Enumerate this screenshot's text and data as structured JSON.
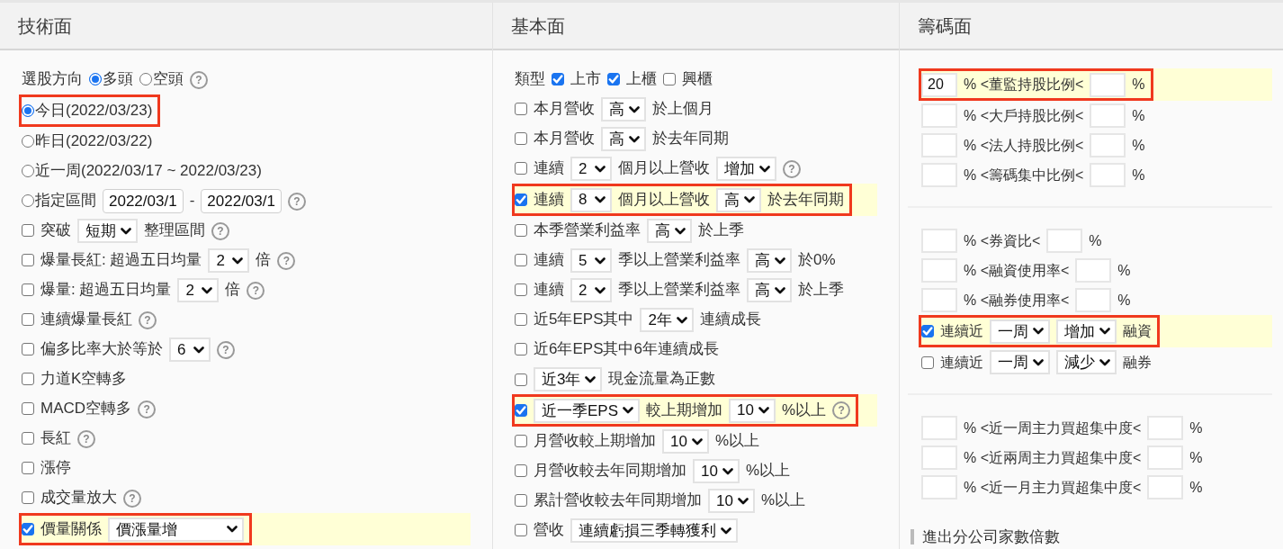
{
  "columns": [
    {
      "title": "技術面",
      "groups": [
        {
          "rows": [
            {
              "highlighted": false,
              "boxed": false,
              "parts": [
                {
                  "kind": "text",
                  "text": "選股方向"
                },
                {
                  "kind": "radio",
                  "selected": true,
                  "label": "多頭"
                },
                {
                  "kind": "radio",
                  "selected": false,
                  "label": "空頭"
                },
                {
                  "kind": "help",
                  "label": "?"
                }
              ]
            },
            {
              "highlighted": false,
              "boxed": true,
              "parts": [
                {
                  "kind": "radio",
                  "selected": true,
                  "label": "今日(2022/03/23)"
                }
              ]
            },
            {
              "highlighted": false,
              "boxed": false,
              "parts": [
                {
                  "kind": "radio",
                  "selected": false,
                  "label": "昨日(2022/03/22)"
                }
              ]
            },
            {
              "highlighted": false,
              "boxed": false,
              "parts": [
                {
                  "kind": "radio",
                  "selected": false,
                  "label": "近一周(2022/03/17 ~ 2022/03/23)"
                }
              ]
            },
            {
              "highlighted": false,
              "boxed": false,
              "parts": [
                {
                  "kind": "radio",
                  "selected": false,
                  "label": "指定區間"
                },
                {
                  "kind": "input",
                  "value": "2022/03/1"
                },
                {
                  "kind": "text",
                  "text": "-"
                },
                {
                  "kind": "input",
                  "value": "2022/03/1"
                },
                {
                  "kind": "help",
                  "label": "?"
                }
              ]
            },
            {
              "highlighted": false,
              "boxed": false,
              "parts": [
                {
                  "kind": "checkbox",
                  "checked": false,
                  "label": "突破"
                },
                {
                  "kind": "select",
                  "value": "短期"
                },
                {
                  "kind": "text",
                  "text": "整理區間"
                },
                {
                  "kind": "help",
                  "label": "?"
                }
              ]
            },
            {
              "highlighted": false,
              "boxed": false,
              "parts": [
                {
                  "kind": "checkbox",
                  "checked": false,
                  "label": "爆量長紅: 超過五日均量"
                },
                {
                  "kind": "select",
                  "value": "2"
                },
                {
                  "kind": "text",
                  "text": "倍"
                },
                {
                  "kind": "help",
                  "label": "?"
                }
              ]
            },
            {
              "highlighted": false,
              "boxed": false,
              "parts": [
                {
                  "kind": "checkbox",
                  "checked": false,
                  "label": "爆量: 超過五日均量"
                },
                {
                  "kind": "select",
                  "value": "2"
                },
                {
                  "kind": "text",
                  "text": "倍"
                },
                {
                  "kind": "help",
                  "label": "?"
                }
              ]
            },
            {
              "highlighted": false,
              "boxed": false,
              "parts": [
                {
                  "kind": "checkbox",
                  "checked": false,
                  "label": "連續爆量長紅"
                },
                {
                  "kind": "help",
                  "label": "?"
                }
              ]
            },
            {
              "highlighted": false,
              "boxed": false,
              "parts": [
                {
                  "kind": "checkbox",
                  "checked": false,
                  "label": "偏多比率大於等於"
                },
                {
                  "kind": "select",
                  "value": "6"
                },
                {
                  "kind": "help",
                  "label": "?"
                }
              ]
            },
            {
              "highlighted": false,
              "boxed": false,
              "parts": [
                {
                  "kind": "checkbox",
                  "checked": false,
                  "label": "力道K空轉多"
                }
              ]
            },
            {
              "highlighted": false,
              "boxed": false,
              "parts": [
                {
                  "kind": "checkbox",
                  "checked": false,
                  "label": "MACD空轉多"
                },
                {
                  "kind": "help",
                  "label": "?"
                }
              ]
            },
            {
              "highlighted": false,
              "boxed": false,
              "parts": [
                {
                  "kind": "checkbox",
                  "checked": false,
                  "label": "長紅"
                },
                {
                  "kind": "help",
                  "label": "?"
                }
              ]
            },
            {
              "highlighted": false,
              "boxed": false,
              "parts": [
                {
                  "kind": "checkbox",
                  "checked": false,
                  "label": "漲停"
                }
              ]
            },
            {
              "highlighted": false,
              "boxed": false,
              "parts": [
                {
                  "kind": "checkbox",
                  "checked": false,
                  "label": "成交量放大"
                },
                {
                  "kind": "help",
                  "label": "?"
                }
              ]
            },
            {
              "highlighted": true,
              "boxed": true,
              "parts": [
                {
                  "kind": "checkbox",
                  "checked": true,
                  "label": "價量關係"
                },
                {
                  "kind": "select",
                  "value": "價漲量增"
                }
              ]
            }
          ]
        }
      ]
    },
    {
      "title": "基本面",
      "groups": [
        {
          "rows": [
            {
              "highlighted": false,
              "boxed": false,
              "parts": [
                {
                  "kind": "text",
                  "text": "類型"
                },
                {
                  "kind": "checkbox",
                  "checked": true,
                  "label": "上市"
                },
                {
                  "kind": "checkbox",
                  "checked": true,
                  "label": "上櫃"
                },
                {
                  "kind": "checkbox",
                  "checked": false,
                  "label": "興櫃"
                }
              ]
            },
            {
              "highlighted": false,
              "boxed": false,
              "parts": [
                {
                  "kind": "checkbox",
                  "checked": false,
                  "label": "本月營收"
                },
                {
                  "kind": "select",
                  "value": "高"
                },
                {
                  "kind": "text",
                  "text": "於上個月"
                }
              ]
            },
            {
              "highlighted": false,
              "boxed": false,
              "parts": [
                {
                  "kind": "checkbox",
                  "checked": false,
                  "label": "本月營收"
                },
                {
                  "kind": "select",
                  "value": "高"
                },
                {
                  "kind": "text",
                  "text": "於去年同期"
                }
              ]
            },
            {
              "highlighted": false,
              "boxed": false,
              "parts": [
                {
                  "kind": "checkbox",
                  "checked": false,
                  "label": "連續"
                },
                {
                  "kind": "select",
                  "value": "2"
                },
                {
                  "kind": "text",
                  "text": "個月以上營收"
                },
                {
                  "kind": "select",
                  "value": "增加"
                },
                {
                  "kind": "help",
                  "label": "?"
                }
              ]
            },
            {
              "highlighted": true,
              "boxed": true,
              "parts": [
                {
                  "kind": "checkbox",
                  "checked": true,
                  "label": "連續"
                },
                {
                  "kind": "select",
                  "value": "8"
                },
                {
                  "kind": "text",
                  "text": "個月以上營收"
                },
                {
                  "kind": "select",
                  "value": "高"
                },
                {
                  "kind": "text",
                  "text": "於去年同期"
                }
              ]
            },
            {
              "highlighted": false,
              "boxed": false,
              "parts": [
                {
                  "kind": "checkbox",
                  "checked": false,
                  "label": "本季營業利益率"
                },
                {
                  "kind": "select",
                  "value": "高"
                },
                {
                  "kind": "text",
                  "text": "於上季"
                }
              ]
            },
            {
              "highlighted": false,
              "boxed": false,
              "parts": [
                {
                  "kind": "checkbox",
                  "checked": false,
                  "label": "連續"
                },
                {
                  "kind": "select",
                  "value": "5"
                },
                {
                  "kind": "text",
                  "text": "季以上營業利益率"
                },
                {
                  "kind": "select",
                  "value": "高"
                },
                {
                  "kind": "text",
                  "text": "於0%"
                }
              ]
            },
            {
              "highlighted": false,
              "boxed": false,
              "parts": [
                {
                  "kind": "checkbox",
                  "checked": false,
                  "label": "連續"
                },
                {
                  "kind": "select",
                  "value": "2"
                },
                {
                  "kind": "text",
                  "text": "季以上營業利益率"
                },
                {
                  "kind": "select",
                  "value": "高"
                },
                {
                  "kind": "text",
                  "text": "於上季"
                }
              ]
            },
            {
              "highlighted": false,
              "boxed": false,
              "parts": [
                {
                  "kind": "checkbox",
                  "checked": false,
                  "label": "近5年EPS其中"
                },
                {
                  "kind": "select",
                  "value": "2年"
                },
                {
                  "kind": "text",
                  "text": "連續成長"
                }
              ]
            },
            {
              "highlighted": false,
              "boxed": false,
              "parts": [
                {
                  "kind": "checkbox",
                  "checked": false,
                  "label": "近6年EPS其中6年連續成長"
                }
              ]
            },
            {
              "highlighted": false,
              "boxed": false,
              "parts": [
                {
                  "kind": "checkbox",
                  "checked": false
                },
                {
                  "kind": "select",
                  "value": "近3年"
                },
                {
                  "kind": "text",
                  "text": "現金流量為正數"
                }
              ]
            },
            {
              "highlighted": true,
              "boxed": true,
              "parts": [
                {
                  "kind": "checkbox",
                  "checked": true
                },
                {
                  "kind": "select",
                  "value": "近一季EPS"
                },
                {
                  "kind": "text",
                  "text": "較上期增加"
                },
                {
                  "kind": "select",
                  "value": "10"
                },
                {
                  "kind": "text",
                  "text": "%以上"
                },
                {
                  "kind": "help",
                  "label": "?"
                }
              ]
            },
            {
              "highlighted": false,
              "boxed": false,
              "parts": [
                {
                  "kind": "checkbox",
                  "checked": false,
                  "label": "月營收較上期增加"
                },
                {
                  "kind": "select",
                  "value": "10"
                },
                {
                  "kind": "text",
                  "text": "%以上"
                }
              ]
            },
            {
              "highlighted": false,
              "boxed": false,
              "parts": [
                {
                  "kind": "checkbox",
                  "checked": false,
                  "label": "月營收較去年同期增加"
                },
                {
                  "kind": "select",
                  "value": "10"
                },
                {
                  "kind": "text",
                  "text": "%以上"
                }
              ]
            },
            {
              "highlighted": false,
              "boxed": false,
              "parts": [
                {
                  "kind": "checkbox",
                  "checked": false,
                  "label": "累計營收較去年同期增加"
                },
                {
                  "kind": "select",
                  "value": "10"
                },
                {
                  "kind": "text",
                  "text": "%以上"
                }
              ]
            },
            {
              "highlighted": false,
              "boxed": false,
              "parts": [
                {
                  "kind": "checkbox",
                  "checked": false,
                  "label": "營收"
                },
                {
                  "kind": "select",
                  "value": "連續虧損三季轉獲利"
                }
              ]
            }
          ]
        }
      ]
    },
    {
      "title": "籌碼面",
      "groups": [
        {
          "rows": [
            {
              "highlighted": true,
              "boxed": true,
              "parts": [
                {
                  "kind": "input",
                  "value": "20"
                },
                {
                  "kind": "text",
                  "text": "% <董監持股比例<"
                },
                {
                  "kind": "input"
                },
                {
                  "kind": "text",
                  "text": "%"
                }
              ]
            },
            {
              "highlighted": false,
              "boxed": false,
              "parts": [
                {
                  "kind": "input"
                },
                {
                  "kind": "text",
                  "text": "% <大戶持股比例<"
                },
                {
                  "kind": "input"
                },
                {
                  "kind": "text",
                  "text": "%"
                }
              ]
            },
            {
              "highlighted": false,
              "boxed": false,
              "parts": [
                {
                  "kind": "input"
                },
                {
                  "kind": "text",
                  "text": "% <法人持股比例<"
                },
                {
                  "kind": "input"
                },
                {
                  "kind": "text",
                  "text": "%"
                }
              ]
            },
            {
              "highlighted": false,
              "boxed": false,
              "parts": [
                {
                  "kind": "input"
                },
                {
                  "kind": "text",
                  "text": "% <籌碼集中比例<"
                },
                {
                  "kind": "input"
                },
                {
                  "kind": "text",
                  "text": "%"
                }
              ]
            }
          ]
        },
        {
          "rows": [
            {
              "highlighted": false,
              "boxed": false,
              "parts": [
                {
                  "kind": "input"
                },
                {
                  "kind": "text",
                  "text": "% <券資比<"
                },
                {
                  "kind": "input"
                },
                {
                  "kind": "text",
                  "text": "%"
                }
              ]
            },
            {
              "highlighted": false,
              "boxed": false,
              "parts": [
                {
                  "kind": "input"
                },
                {
                  "kind": "text",
                  "text": "% <融資使用率<"
                },
                {
                  "kind": "input"
                },
                {
                  "kind": "text",
                  "text": "%"
                }
              ]
            },
            {
              "highlighted": false,
              "boxed": false,
              "parts": [
                {
                  "kind": "input"
                },
                {
                  "kind": "text",
                  "text": "% <融券使用率<"
                },
                {
                  "kind": "input"
                },
                {
                  "kind": "text",
                  "text": "%"
                }
              ]
            },
            {
              "highlighted": true,
              "boxed": true,
              "parts": [
                {
                  "kind": "checkbox",
                  "checked": true,
                  "label": "連續近"
                },
                {
                  "kind": "select",
                  "value": "一周"
                },
                {
                  "kind": "select",
                  "value": "增加"
                },
                {
                  "kind": "text",
                  "text": "融資"
                }
              ]
            },
            {
              "highlighted": false,
              "boxed": false,
              "parts": [
                {
                  "kind": "checkbox",
                  "checked": false,
                  "label": "連續近"
                },
                {
                  "kind": "select",
                  "value": "一周"
                },
                {
                  "kind": "select",
                  "value": "減少"
                },
                {
                  "kind": "text",
                  "text": "融券"
                }
              ]
            }
          ]
        },
        {
          "rows": [
            {
              "highlighted": false,
              "boxed": false,
              "parts": [
                {
                  "kind": "input"
                },
                {
                  "kind": "text",
                  "text": "% <近一周主力買超集中度<"
                },
                {
                  "kind": "input"
                },
                {
                  "kind": "text",
                  "text": "%"
                }
              ]
            },
            {
              "highlighted": false,
              "boxed": false,
              "parts": [
                {
                  "kind": "input"
                },
                {
                  "kind": "text",
                  "text": "% <近兩周主力買超集中度<"
                },
                {
                  "kind": "input"
                },
                {
                  "kind": "text",
                  "text": "%"
                }
              ]
            },
            {
              "highlighted": false,
              "boxed": false,
              "parts": [
                {
                  "kind": "input"
                },
                {
                  "kind": "text",
                  "text": "% <近一月主力買超集中度<"
                },
                {
                  "kind": "input"
                },
                {
                  "kind": "text",
                  "text": "%"
                }
              ]
            }
          ]
        }
      ],
      "subheading": "進出分公司家數倍數"
    }
  ]
}
